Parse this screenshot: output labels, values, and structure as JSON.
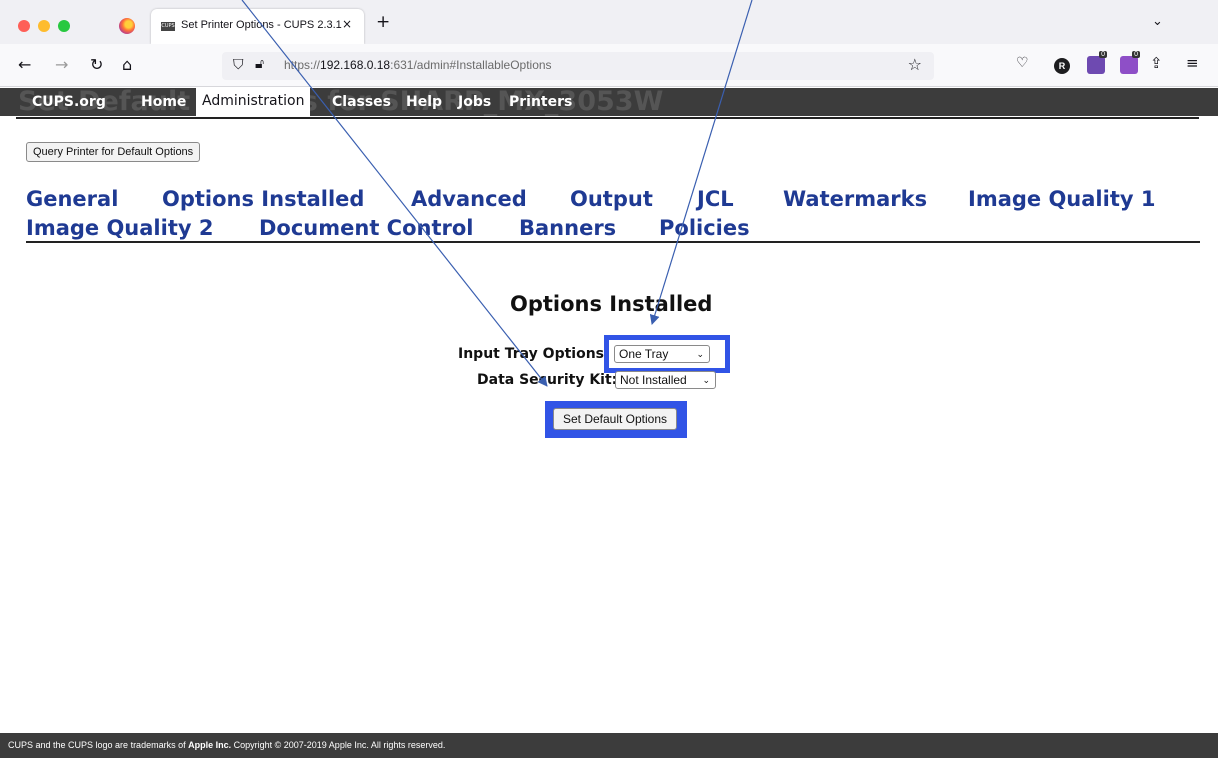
{
  "browser": {
    "tab_title": "Set Printer Options - CUPS 2.3.1",
    "tab_favicon_text": "CUPS",
    "tab_close": "×",
    "new_tab": "+",
    "tabs_menu": "⌄",
    "url_prefix": "https://",
    "url_host": "192.168.0.18",
    "url_rest": ":631/admin#InstallableOptions",
    "ext_badge_1": "0",
    "ext_badge_2": "0",
    "ext_r": "R"
  },
  "cups_nav": {
    "ghost_title": "Set Default Options for SHARP_MX_3053W",
    "items": [
      "CUPS.org",
      "Home",
      "Administration",
      "Classes",
      "Help",
      "Jobs",
      "Printers"
    ]
  },
  "query_button": "Query Printer for Default Options",
  "section_tabs": {
    "row1": [
      "General",
      "Options Installed",
      "Advanced",
      "Output",
      "JCL",
      "Watermarks",
      "Image Quality 1"
    ],
    "row2": [
      "Image Quality 2",
      "Document Control",
      "Banners",
      "Policies"
    ]
  },
  "form": {
    "title": "Options Installed",
    "input_tray_label": "Input Tray Options",
    "input_tray_value": "One Tray",
    "dsk_label": "Data Security Kit:",
    "dsk_value": "Not Installed",
    "submit": "Set Default Options"
  },
  "footer": {
    "before": "CUPS and the CUPS logo are trademarks of ",
    "brand": "Apple Inc.",
    "after": " Copyright © 2007-2019 Apple Inc. All rights reserved."
  },
  "colors": {
    "highlight": "#3154e6",
    "link": "#1f3a93",
    "nav_bar": "#3c3c3c"
  }
}
